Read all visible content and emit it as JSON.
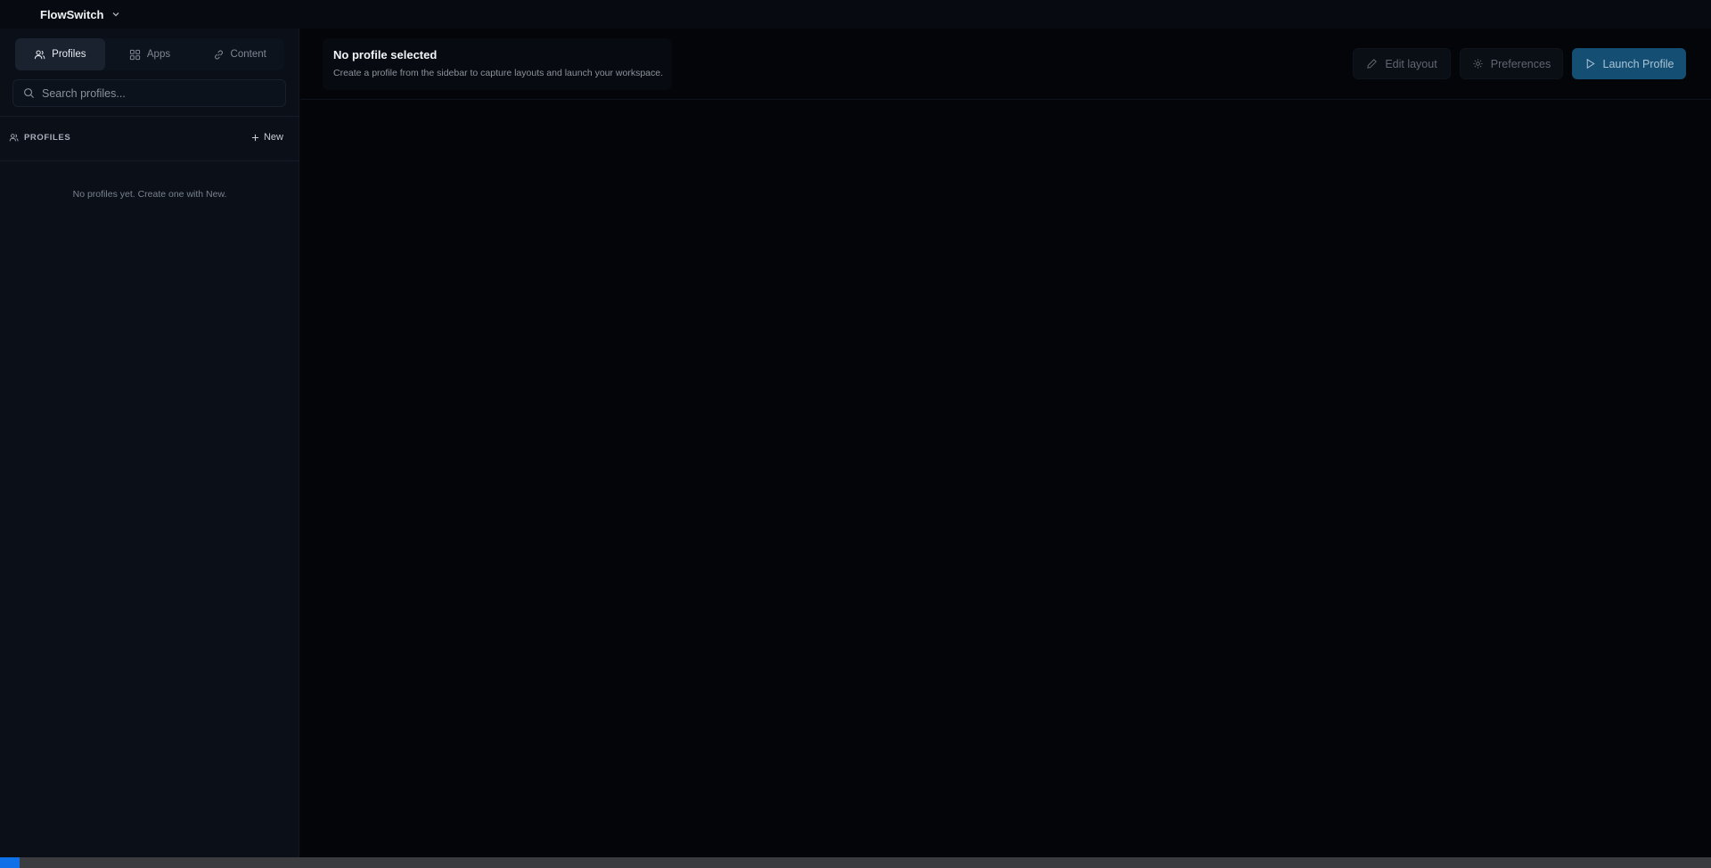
{
  "app": {
    "title": "FlowSwitch"
  },
  "sidebar": {
    "tabs": [
      {
        "label": "Profiles",
        "icon": "users-icon",
        "active": true
      },
      {
        "label": "Apps",
        "icon": "grid-icon",
        "active": false
      },
      {
        "label": "Content",
        "icon": "link-icon",
        "active": false
      }
    ],
    "search": {
      "placeholder": "Search profiles...",
      "value": ""
    },
    "section_label": "PROFILES",
    "new_label": "New",
    "empty_message": "No profiles yet. Create one with New."
  },
  "main": {
    "title": "No profile selected",
    "subtitle": "Create a profile from the sidebar to capture layouts and launch your workspace.",
    "actions": {
      "edit_label": "Edit layout",
      "prefs_label": "Preferences",
      "launch_label": "Launch Profile"
    }
  },
  "colors": {
    "accent": "#154e73",
    "status_indicator": "#1070e8",
    "background": "#05070b",
    "sidebar": "#0a0f18"
  }
}
